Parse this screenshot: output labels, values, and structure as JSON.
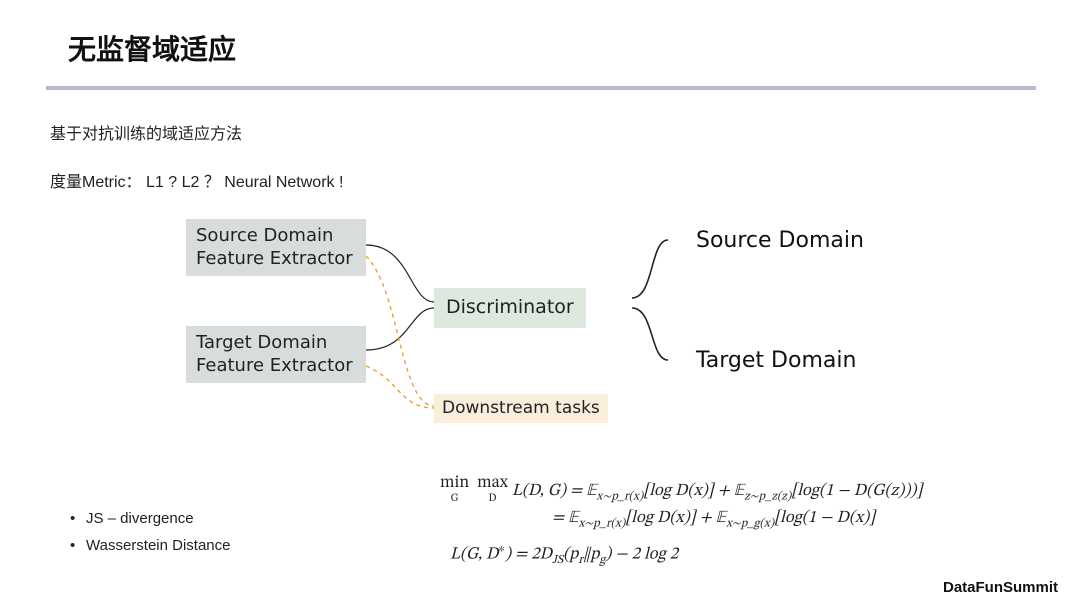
{
  "title": "无监督域适应",
  "subtitle1": "基于对抗训练的域适应方法",
  "subtitle2": "度量Metric： L1 ? L2 ？ Neural Network !",
  "diagram": {
    "source_box_l1": "Source Domain",
    "source_box_l2": "Feature Extractor",
    "target_box_l1": "Target Domain",
    "target_box_l2": "Feature Extractor",
    "discriminator": "Discriminator",
    "downstream": "Downstream tasks",
    "out_source": "Source Domain",
    "out_target": "Target Domain"
  },
  "bullets": {
    "b1": "JS – divergence",
    "b2": "Wasserstein Distance"
  },
  "equations": {
    "line1_pre": "min",
    "line1_pre_sub": "G",
    "line1_pre2": "max",
    "line1_pre2_sub": "D",
    "line1_a": " L(D, G) = 𝔼",
    "line1_sub1": "x∼p_r(x)",
    "line1_b": "[log D(x)] + 𝔼",
    "line1_sub2": "z∼p_z(z)",
    "line1_c": "[log(1 − D(G(z)))]",
    "line2_a": "= 𝔼",
    "line2_sub1": "x∼p_r(x)",
    "line2_b": "[log D(x)] + 𝔼",
    "line2_sub2": "x∼p_g(x)",
    "line2_c": "[log(1 − D(x)]",
    "line3_a": "L(G, D",
    "line3_sup": "∗",
    "line3_b": ") = 2D",
    "line3_sub": "JS",
    "line3_c": "(p",
    "line3_sub2": "r",
    "line3_d": "‖p",
    "line3_sub3": "g",
    "line3_e": ") − 2 log 2"
  },
  "footer": "DataFunSummit"
}
